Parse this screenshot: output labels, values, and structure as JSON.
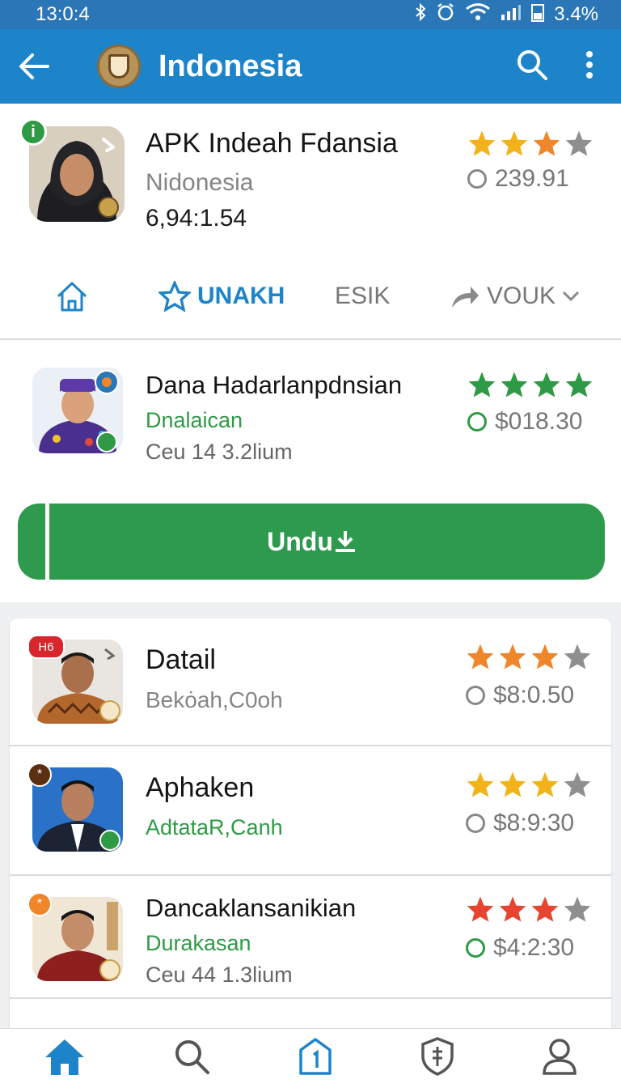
{
  "status_bar": {
    "time": "13:0:4",
    "battery": "3.4%"
  },
  "app_bar": {
    "title": "Indonesia"
  },
  "featured": {
    "title": "APK Indeah Fdansia",
    "subtitle": "Nidonesia",
    "meta": "6,94:1.54",
    "badge": "i",
    "rating": "239.91",
    "stars": 3
  },
  "tabs": [
    {
      "label": "UNAKH"
    },
    {
      "label": "ESIK"
    },
    {
      "label": "VOUK"
    }
  ],
  "highlight": {
    "title": "Dana Hadarlanpdnsian",
    "developer": "Dnalaican",
    "meta": "Ceu 14 3.2lium",
    "price": "$018.30",
    "stars": 4
  },
  "download_button": {
    "label": "Undu"
  },
  "list": [
    {
      "title": "Datail",
      "subtitle": "Bekȯah,C0oh",
      "price": "$8:0.50",
      "badge": "H6",
      "stars": 3
    },
    {
      "title": "Aphaken",
      "subtitle": "AdtataR,Canh",
      "price": "$8:9:30",
      "badge": "*",
      "stars": 3
    },
    {
      "title": "Dancaklansanikian",
      "subtitle": "Durakasan",
      "meta": "Ceu 44 1.3lium",
      "price": "$4:2:30",
      "badge": "*",
      "stars": 3
    }
  ],
  "colors": {
    "primary": "#1d84c9",
    "green": "#2e9a4d",
    "star_gold": "#f2b21a",
    "star_orange": "#f0862a",
    "star_red": "#e8442f",
    "star_green": "#2e9a45"
  }
}
